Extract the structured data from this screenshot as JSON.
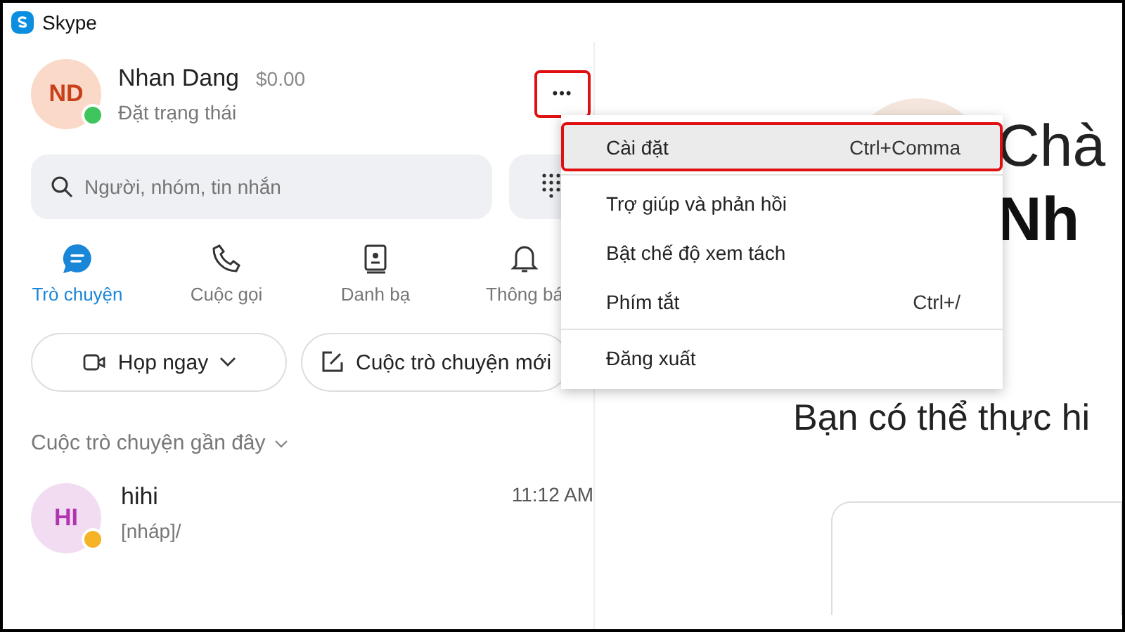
{
  "window": {
    "title": "Skype"
  },
  "profile": {
    "initials": "ND",
    "name": "Nhan Dang",
    "balance": "$0.00",
    "status": "Đặt trạng thái",
    "online": true
  },
  "more_button": {
    "label": "•••",
    "highlighted": true
  },
  "search": {
    "placeholder": "Người, nhóm, tin nhắn"
  },
  "tabs": [
    {
      "label": "Trò chuyện",
      "selected": true
    },
    {
      "label": "Cuộc gọi",
      "selected": false
    },
    {
      "label": "Danh bạ",
      "selected": false
    },
    {
      "label": "Thông bá",
      "selected": false
    }
  ],
  "actions": [
    {
      "label": "Họp ngay",
      "dropdown": true
    },
    {
      "label": "Cuộc trò chuyện mới",
      "dropdown": false
    }
  ],
  "recent": {
    "heading": "Cuộc trò chuyện gần đây",
    "chats": [
      {
        "initials": "HI",
        "name": "hihi",
        "preview": "[nháp]/",
        "time": "11:12 AM",
        "color": "#f5b325"
      }
    ]
  },
  "menu": {
    "sections": [
      [
        {
          "label": "Cài đặt",
          "shortcut": "Ctrl+Comma",
          "highlighted": true
        }
      ],
      [
        {
          "label": "Trợ giúp và phản hồi",
          "highlighted": false
        },
        {
          "label": "Bật chế độ xem tách",
          "highlighted": false
        },
        {
          "label": "Phím tắt",
          "shortcut": "Ctrl+/",
          "highlighted": false
        }
      ],
      [
        {
          "label": "Đăng xuất",
          "highlighted": false
        }
      ]
    ]
  },
  "welcome": {
    "greeting": "Chà",
    "name": "Nh",
    "subtitle": "Bạn có thể thực hi"
  }
}
